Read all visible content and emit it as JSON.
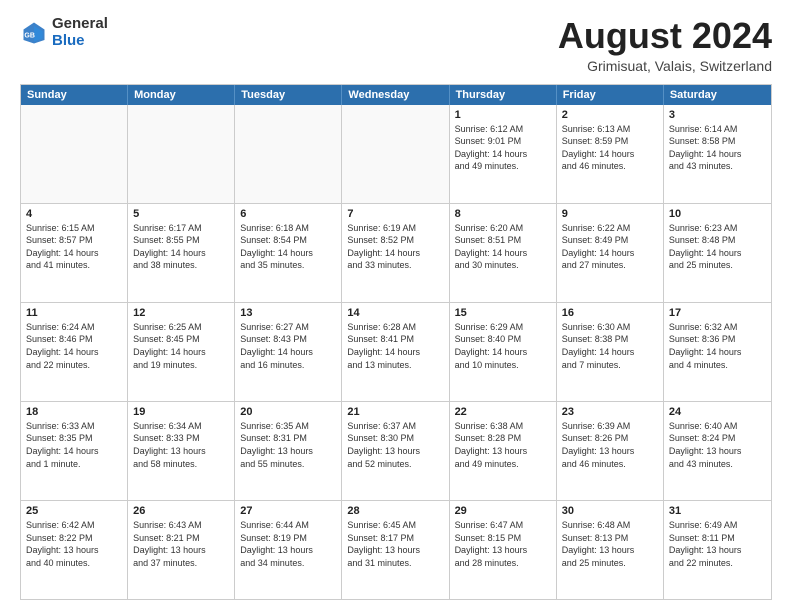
{
  "header": {
    "logo": {
      "general": "General",
      "blue": "Blue"
    },
    "title": "August 2024",
    "location": "Grimisuat, Valais, Switzerland"
  },
  "weekdays": [
    "Sunday",
    "Monday",
    "Tuesday",
    "Wednesday",
    "Thursday",
    "Friday",
    "Saturday"
  ],
  "rows": [
    [
      {
        "day": "",
        "text": "",
        "empty": true
      },
      {
        "day": "",
        "text": "",
        "empty": true
      },
      {
        "day": "",
        "text": "",
        "empty": true
      },
      {
        "day": "",
        "text": "",
        "empty": true
      },
      {
        "day": "1",
        "text": "Sunrise: 6:12 AM\nSunset: 9:01 PM\nDaylight: 14 hours\nand 49 minutes."
      },
      {
        "day": "2",
        "text": "Sunrise: 6:13 AM\nSunset: 8:59 PM\nDaylight: 14 hours\nand 46 minutes."
      },
      {
        "day": "3",
        "text": "Sunrise: 6:14 AM\nSunset: 8:58 PM\nDaylight: 14 hours\nand 43 minutes."
      }
    ],
    [
      {
        "day": "4",
        "text": "Sunrise: 6:15 AM\nSunset: 8:57 PM\nDaylight: 14 hours\nand 41 minutes."
      },
      {
        "day": "5",
        "text": "Sunrise: 6:17 AM\nSunset: 8:55 PM\nDaylight: 14 hours\nand 38 minutes."
      },
      {
        "day": "6",
        "text": "Sunrise: 6:18 AM\nSunset: 8:54 PM\nDaylight: 14 hours\nand 35 minutes."
      },
      {
        "day": "7",
        "text": "Sunrise: 6:19 AM\nSunset: 8:52 PM\nDaylight: 14 hours\nand 33 minutes."
      },
      {
        "day": "8",
        "text": "Sunrise: 6:20 AM\nSunset: 8:51 PM\nDaylight: 14 hours\nand 30 minutes."
      },
      {
        "day": "9",
        "text": "Sunrise: 6:22 AM\nSunset: 8:49 PM\nDaylight: 14 hours\nand 27 minutes."
      },
      {
        "day": "10",
        "text": "Sunrise: 6:23 AM\nSunset: 8:48 PM\nDaylight: 14 hours\nand 25 minutes."
      }
    ],
    [
      {
        "day": "11",
        "text": "Sunrise: 6:24 AM\nSunset: 8:46 PM\nDaylight: 14 hours\nand 22 minutes."
      },
      {
        "day": "12",
        "text": "Sunrise: 6:25 AM\nSunset: 8:45 PM\nDaylight: 14 hours\nand 19 minutes."
      },
      {
        "day": "13",
        "text": "Sunrise: 6:27 AM\nSunset: 8:43 PM\nDaylight: 14 hours\nand 16 minutes."
      },
      {
        "day": "14",
        "text": "Sunrise: 6:28 AM\nSunset: 8:41 PM\nDaylight: 14 hours\nand 13 minutes."
      },
      {
        "day": "15",
        "text": "Sunrise: 6:29 AM\nSunset: 8:40 PM\nDaylight: 14 hours\nand 10 minutes."
      },
      {
        "day": "16",
        "text": "Sunrise: 6:30 AM\nSunset: 8:38 PM\nDaylight: 14 hours\nand 7 minutes."
      },
      {
        "day": "17",
        "text": "Sunrise: 6:32 AM\nSunset: 8:36 PM\nDaylight: 14 hours\nand 4 minutes."
      }
    ],
    [
      {
        "day": "18",
        "text": "Sunrise: 6:33 AM\nSunset: 8:35 PM\nDaylight: 14 hours\nand 1 minute."
      },
      {
        "day": "19",
        "text": "Sunrise: 6:34 AM\nSunset: 8:33 PM\nDaylight: 13 hours\nand 58 minutes."
      },
      {
        "day": "20",
        "text": "Sunrise: 6:35 AM\nSunset: 8:31 PM\nDaylight: 13 hours\nand 55 minutes."
      },
      {
        "day": "21",
        "text": "Sunrise: 6:37 AM\nSunset: 8:30 PM\nDaylight: 13 hours\nand 52 minutes."
      },
      {
        "day": "22",
        "text": "Sunrise: 6:38 AM\nSunset: 8:28 PM\nDaylight: 13 hours\nand 49 minutes."
      },
      {
        "day": "23",
        "text": "Sunrise: 6:39 AM\nSunset: 8:26 PM\nDaylight: 13 hours\nand 46 minutes."
      },
      {
        "day": "24",
        "text": "Sunrise: 6:40 AM\nSunset: 8:24 PM\nDaylight: 13 hours\nand 43 minutes."
      }
    ],
    [
      {
        "day": "25",
        "text": "Sunrise: 6:42 AM\nSunset: 8:22 PM\nDaylight: 13 hours\nand 40 minutes."
      },
      {
        "day": "26",
        "text": "Sunrise: 6:43 AM\nSunset: 8:21 PM\nDaylight: 13 hours\nand 37 minutes."
      },
      {
        "day": "27",
        "text": "Sunrise: 6:44 AM\nSunset: 8:19 PM\nDaylight: 13 hours\nand 34 minutes."
      },
      {
        "day": "28",
        "text": "Sunrise: 6:45 AM\nSunset: 8:17 PM\nDaylight: 13 hours\nand 31 minutes."
      },
      {
        "day": "29",
        "text": "Sunrise: 6:47 AM\nSunset: 8:15 PM\nDaylight: 13 hours\nand 28 minutes."
      },
      {
        "day": "30",
        "text": "Sunrise: 6:48 AM\nSunset: 8:13 PM\nDaylight: 13 hours\nand 25 minutes."
      },
      {
        "day": "31",
        "text": "Sunrise: 6:49 AM\nSunset: 8:11 PM\nDaylight: 13 hours\nand 22 minutes."
      }
    ]
  ]
}
